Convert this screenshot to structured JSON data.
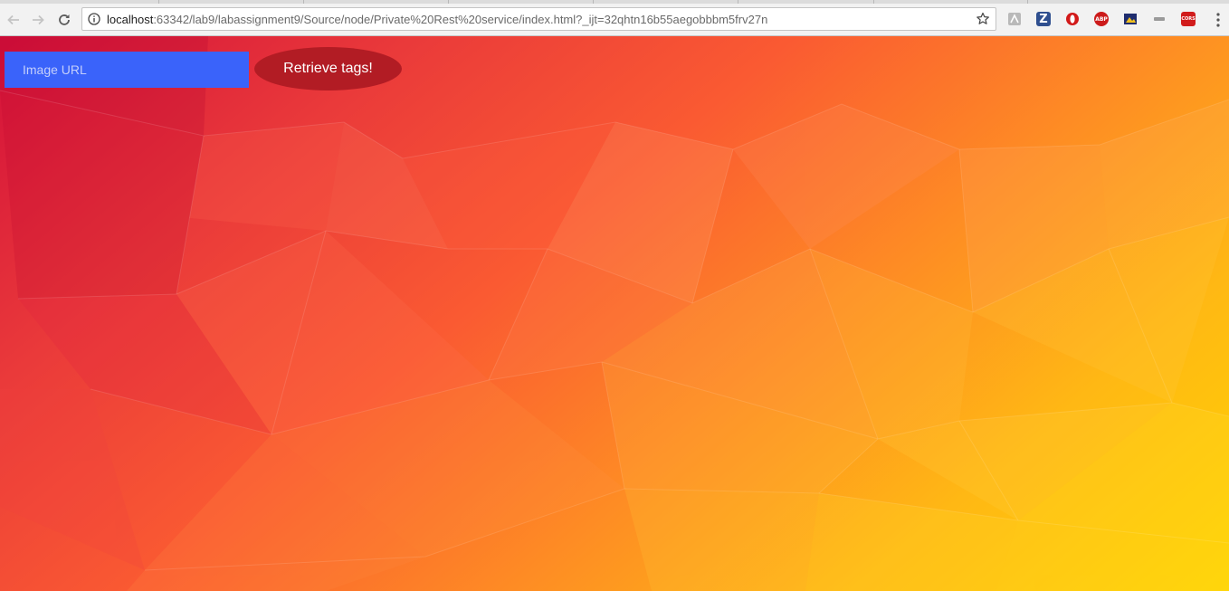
{
  "browser": {
    "url_host": "localhost",
    "url_rest": ":63342/lab9/labassignment9/Source/node/Private%20Rest%20service/index.html?_ijt=32qhtn16b55aegobbbm5frv27n",
    "extensions": [
      {
        "name": "pdf-extension-icon",
        "label": ""
      },
      {
        "name": "zotero-extension-icon",
        "label": "Z"
      },
      {
        "name": "opera-extension-icon",
        "label": ""
      },
      {
        "name": "adblock-plus-icon",
        "label": "ABP"
      },
      {
        "name": "bookmark-extension-icon",
        "label": ""
      },
      {
        "name": "mini-extension-icon",
        "label": ""
      },
      {
        "name": "cors-extension-icon",
        "label": "CORS"
      }
    ]
  },
  "page": {
    "input_placeholder": "Image URL",
    "button_label": "Retrieve tags!"
  },
  "colors": {
    "input_bg": "#3a63fa",
    "button_bg": "#b21c24",
    "gradient_start": "#d3103a",
    "gradient_end": "#ffd400"
  }
}
